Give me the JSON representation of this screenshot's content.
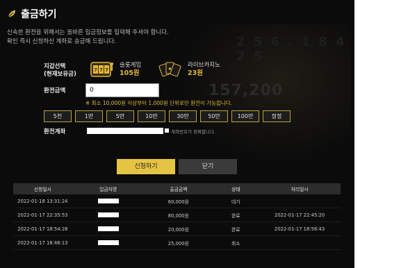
{
  "title": "출금하기",
  "intro": {
    "line1": "신속한 환전을 위해서는 올바른 입금정보를 입력해 주셔야 합니다.",
    "line2": "확인 즉시 신청하신 계좌로 송금해 드립니다."
  },
  "wallet": {
    "label_line1": "지갑선택",
    "label_line2": "(현재보유금)",
    "slot": {
      "name": "슬롯게임",
      "amount": "105원"
    },
    "live": {
      "name": "라이브카지노",
      "amount": "23원"
    }
  },
  "amount": {
    "label": "환전금액",
    "value": "0",
    "notice": "※ 최소 10,000원 이상부터 1,000원 단위로만 환전이 가능합니다."
  },
  "chips": [
    "5천",
    "1만",
    "5만",
    "10만",
    "30만",
    "50만",
    "100만",
    "정정"
  ],
  "account": {
    "label": "환전계좌",
    "note": "계좌번호가 정확합니다."
  },
  "buttons": {
    "apply": "신청하기",
    "close": "닫기"
  },
  "history": {
    "headers": [
      "신청일시",
      "입금자명",
      "출금금액",
      "상태",
      "처리일시"
    ],
    "rows": [
      {
        "date": "2022-01-18 13:31:24",
        "amount": "60,000원",
        "status": "대기",
        "processed": ""
      },
      {
        "date": "2022-01-17 22:35:53",
        "amount": "80,000원",
        "status": "완료",
        "processed": "2022-01-17 22:45:20"
      },
      {
        "date": "2022-01-17 18:54:28",
        "amount": "20,000원",
        "status": "완료",
        "processed": "2022-01-17 18:56:43"
      },
      {
        "date": "2022-01-17 18:46:13",
        "amount": "25,000원",
        "status": "취소",
        "processed": ""
      }
    ]
  },
  "background_text": {
    "big": "157,200",
    "top": "2 5 6 . 1 8 4 2 5"
  },
  "colors": {
    "accent": "#e6c443",
    "gold_text": "#e3b73c",
    "panel": "#0b0b0b"
  },
  "icons": {
    "title": "leaf-icon",
    "slot": "slot-machine-icon",
    "live": "playing-cards-icon"
  }
}
